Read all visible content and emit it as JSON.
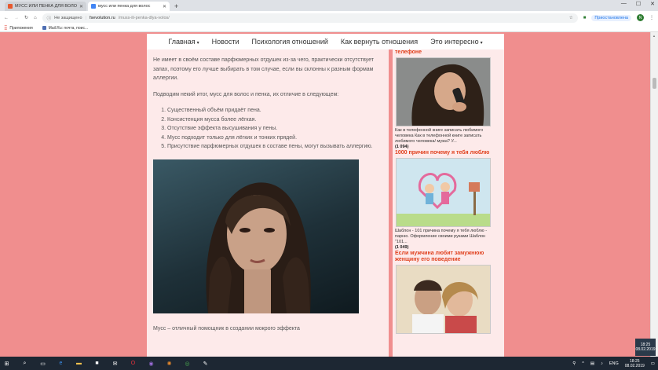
{
  "browser": {
    "tabs": [
      {
        "title": "МУСС ИЛИ ПЕНКА ДЛЯ ВОЛОС"
      },
      {
        "title": "мусс или пенка для волос"
      }
    ],
    "new_tab": "+",
    "window": {
      "minimize": "—",
      "maximize": "☐",
      "close": "✕"
    },
    "security": "Не защищено",
    "url_domain": "fsevolution.ru",
    "url_path": "/muss-ili-penka-dlya-volos/",
    "profile_label": "Приостановлена",
    "profile_initial": "N",
    "bookmarks": [
      {
        "label": "Приложения"
      },
      {
        "label": "Mail.Ru: почта, поис..."
      }
    ]
  },
  "nav": {
    "items": [
      {
        "label": "Главная",
        "caret": "▾"
      },
      {
        "label": "Новости",
        "caret": ""
      },
      {
        "label": "Психология отношений",
        "caret": ""
      },
      {
        "label": "Как вернуть отношения",
        "caret": ""
      },
      {
        "label": "Это интересно",
        "caret": "▾"
      }
    ]
  },
  "article": {
    "p1": "Не имеет в своём составе парфюмерных отдушек из-за чего, практически отсутствует запах, поэтому его лучше выбирать в том случае, если вы склонны к разным формам аллергии.",
    "p2": "Подводим некий итог, мусс для волос и пенка, их отличие в следующем:",
    "list": [
      "Существенный объём придаёт пена.",
      "Консистенция мусса более лёгкая.",
      "Отсутствие эффекта высушивания у пены.",
      "Мусс подходит только для лёгких и тонких прядей.",
      "Присутствие парфюмерных отдушек в составе пены, могут вызывать аллергию."
    ],
    "p3": "Мусс – отличный помощник в создании мокрого эффекта"
  },
  "sidebar": {
    "cards": [
      {
        "title": "телефоне",
        "desc": "Как в телефонной книге записать любимого человека Как в телефонной книге записать любимого человека/ мужа? У...",
        "count": "(1 094)"
      },
      {
        "title": "1000 причин почему я тебя люблю",
        "desc": "Шаблон - 101 причина почему я тебя люблю - парню. Оформление своими руками Шаблон \"101...",
        "count": "(1 049)"
      },
      {
        "title": "Если мужчина любит замужнюю женщину его поведение",
        "desc": "",
        "count": ""
      }
    ]
  },
  "taskbar": {
    "language": "ENG",
    "time": "18:25",
    "date": "08.02.2019"
  }
}
